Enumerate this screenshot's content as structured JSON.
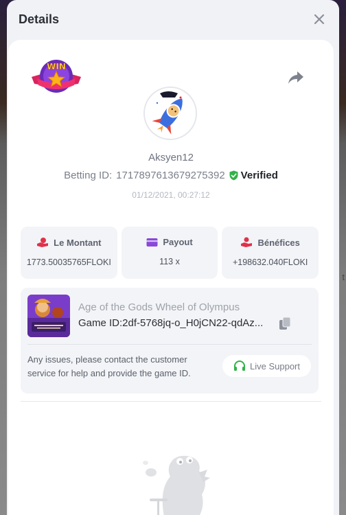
{
  "modal": {
    "title": "Details"
  },
  "user": {
    "username": "Aksyen12",
    "betting_id_label": "Betting ID:",
    "betting_id": "1717897613679275392",
    "verified_label": "Verified",
    "timestamp": "01/12/2021, 00:27:12"
  },
  "badge": {
    "text": "WIN"
  },
  "stats": [
    {
      "label": "Le Montant",
      "value": "1773.50035765FLOKI",
      "icon": "coins-hand-icon"
    },
    {
      "label": "Payout",
      "value": "113 x",
      "icon": "card-icon"
    },
    {
      "label": "Bénéfices",
      "value": "+198632.040FLOKI",
      "icon": "profit-hand-icon"
    }
  ],
  "game": {
    "name": "Age of the Gods Wheel of Olympus",
    "id_text": "Game ID:2df-5768jq-o_H0jCN22-qdAz..."
  },
  "support": {
    "message": "Any issues, please contact the customer service for help and provide the game ID.",
    "button_label": "Live Support"
  },
  "colors": {
    "accent_green": "#2fb34a",
    "profit_red": "#e0314b",
    "payout_purple": "#8a47d9"
  }
}
